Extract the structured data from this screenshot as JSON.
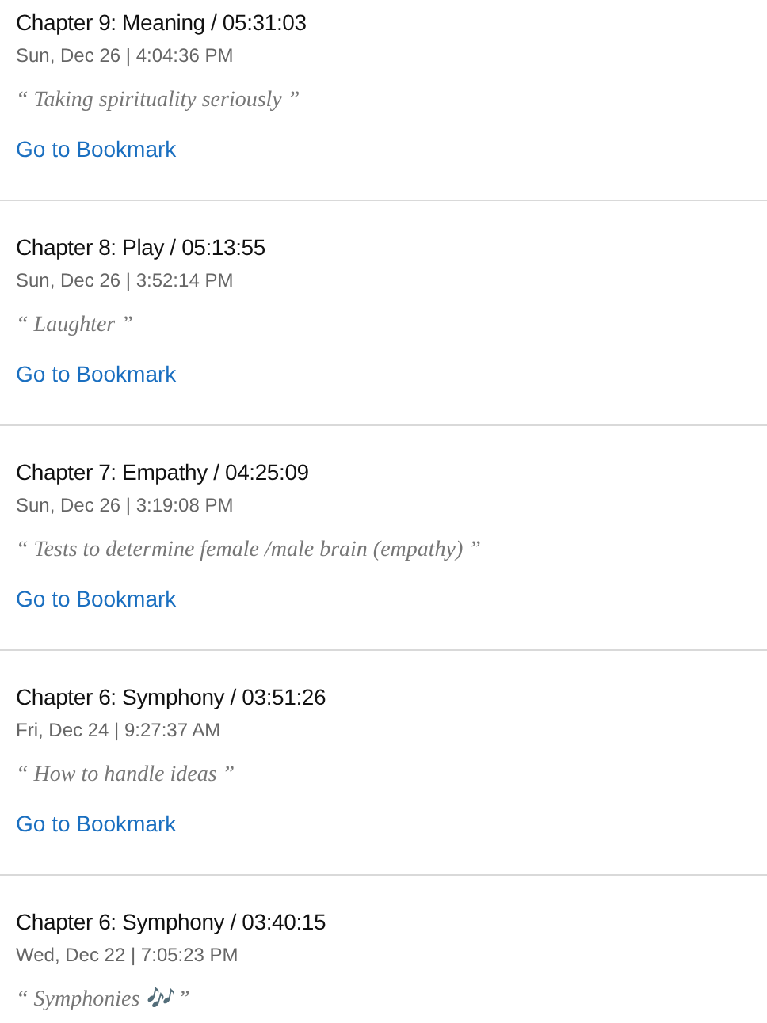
{
  "bookmarks": [
    {
      "title": "Chapter 9: Meaning / 05:31:03",
      "date": "Sun, Dec 26 | 4:04:36 PM",
      "note": "“ Taking spirituality seriously ”",
      "link": "Go to Bookmark"
    },
    {
      "title": "Chapter 8: Play / 05:13:55",
      "date": "Sun, Dec 26 | 3:52:14 PM",
      "note": "“ Laughter ”",
      "link": "Go to Bookmark"
    },
    {
      "title": "Chapter 7: Empathy / 04:25:09",
      "date": "Sun, Dec 26 | 3:19:08 PM",
      "note": "“ Tests to determine female /male brain (empathy) ”",
      "link": "Go to Bookmark"
    },
    {
      "title": "Chapter 6: Symphony / 03:51:26",
      "date": "Fri, Dec 24 | 9:27:37 AM",
      "note": "“ How to handle ideas ”",
      "link": "Go to Bookmark"
    },
    {
      "title": "Chapter 6: Symphony / 03:40:15",
      "date": "Wed, Dec 22 | 7:05:23 PM",
      "note": "“ Symphonies 🎶 ”"
    }
  ]
}
